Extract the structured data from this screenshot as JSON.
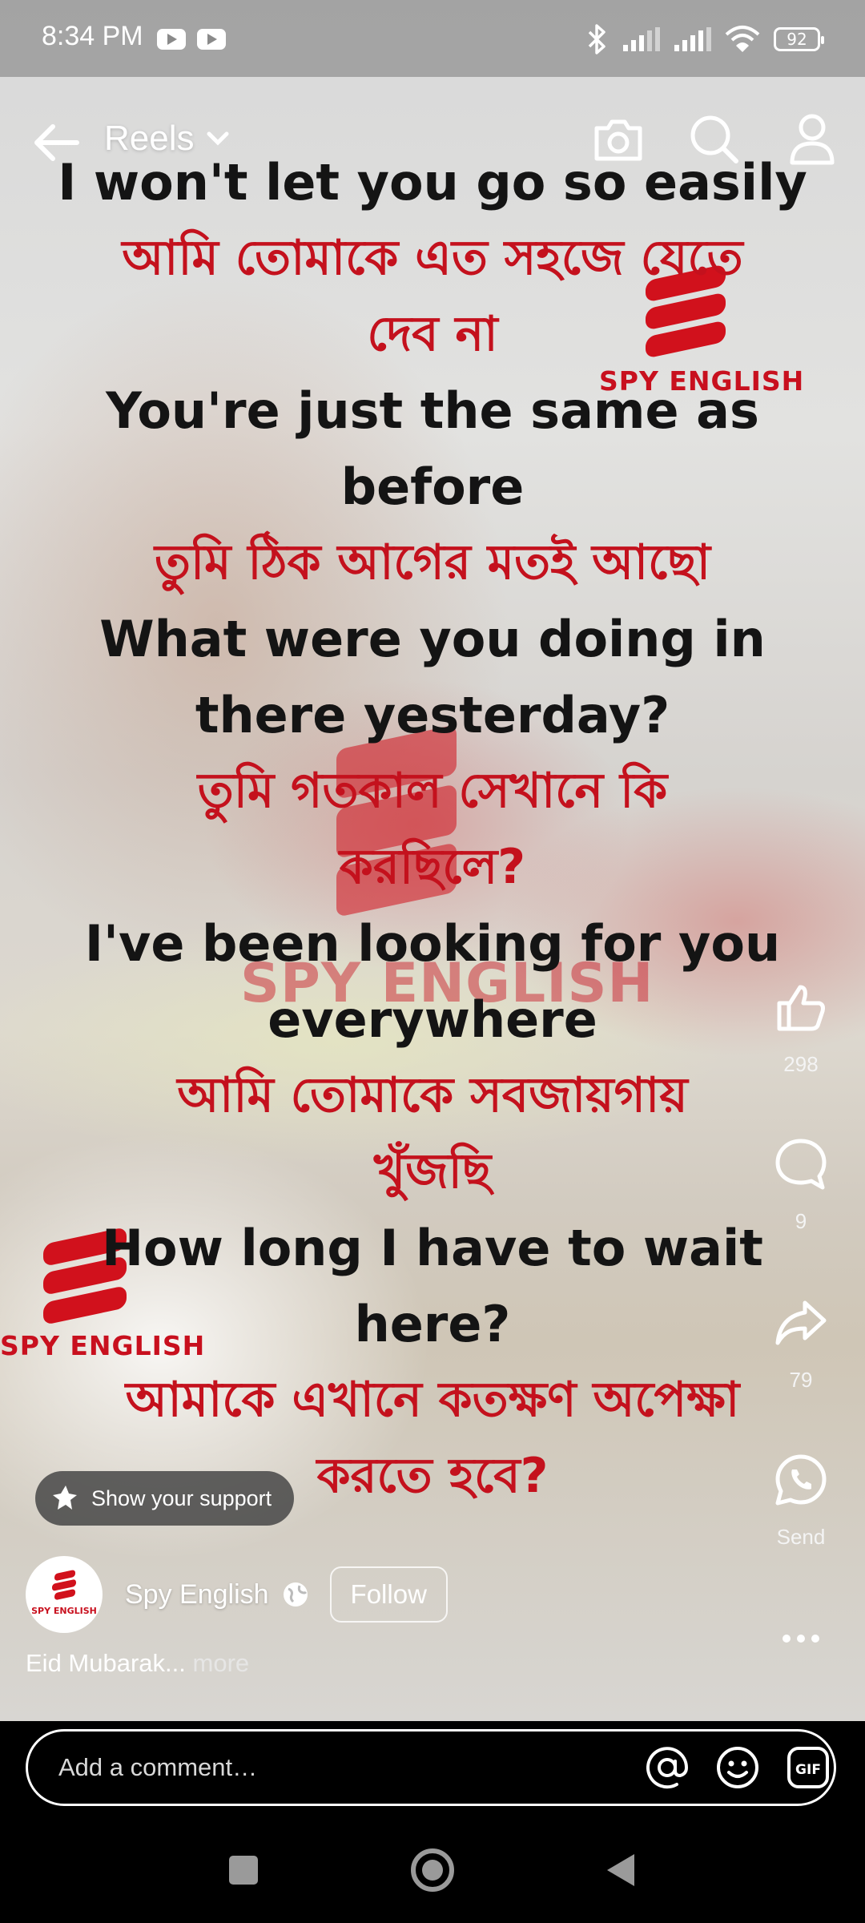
{
  "status_bar": {
    "time": "8:34 PM",
    "battery": "92",
    "icons": [
      "youtube-icon",
      "youtube-icon",
      "bluetooth-icon",
      "signal-icon",
      "signal-icon",
      "wifi-icon",
      "battery-icon"
    ]
  },
  "topbar": {
    "title": "Reels",
    "icons": [
      "back-arrow-icon",
      "chevron-down-icon",
      "camera-icon",
      "search-icon",
      "profile-icon"
    ]
  },
  "overlay_lines": [
    {
      "text": "I won't let you go so easily",
      "lang": "en"
    },
    {
      "text": "আমি তোমাকে এত সহজে যেতে",
      "lang": "bn"
    },
    {
      "text": "দেব না",
      "lang": "bn"
    },
    {
      "text": "You're just the same as",
      "lang": "en"
    },
    {
      "text": "before",
      "lang": "en"
    },
    {
      "text": "তুমি ঠিক আগের মতই আছো",
      "lang": "bn"
    },
    {
      "text": "What were you doing in",
      "lang": "en"
    },
    {
      "text": "there yesterday?",
      "lang": "en"
    },
    {
      "text": "তুমি গতকাল সেখানে কি",
      "lang": "bn"
    },
    {
      "text": "করছিলে?",
      "lang": "bn"
    },
    {
      "text": "I've been looking for you",
      "lang": "en"
    },
    {
      "text": "everywhere",
      "lang": "en"
    },
    {
      "text": "আমি তোমাকে সবজায়গায়",
      "lang": "bn"
    },
    {
      "text": "খুঁজছি",
      "lang": "bn"
    },
    {
      "text": "How long I have to wait",
      "lang": "en"
    },
    {
      "text": "here?",
      "lang": "en"
    },
    {
      "text": "আমাকে এখানে কতক্ষণ অপেক্ষা",
      "lang": "bn"
    },
    {
      "text": "করতে হবে?",
      "lang": "bn"
    }
  ],
  "watermarks": {
    "top_right": "SPY ENGLISH",
    "center": "SPY ENGLISH",
    "bottom_left": "SPY ENGLISH"
  },
  "actions": {
    "like_count": "298",
    "comment_count": "9",
    "share_count": "79",
    "send_label": "Send",
    "icons": [
      "thumbs-up-icon",
      "comment-icon",
      "share-icon",
      "whatsapp-icon",
      "more-icon"
    ]
  },
  "support": {
    "label": "Show your support"
  },
  "author": {
    "name": "Spy English",
    "avatar_text": "SPY ENGLISH",
    "follow_label": "Follow"
  },
  "caption": {
    "text": "Eid Mubarak...",
    "more": "more"
  },
  "comment": {
    "placeholder": "Add a comment…",
    "gif_label": "GIF"
  },
  "colors": {
    "overlay_red": "#c4111d",
    "overlay_black": "#141414",
    "brand_red": "#d1111c"
  }
}
